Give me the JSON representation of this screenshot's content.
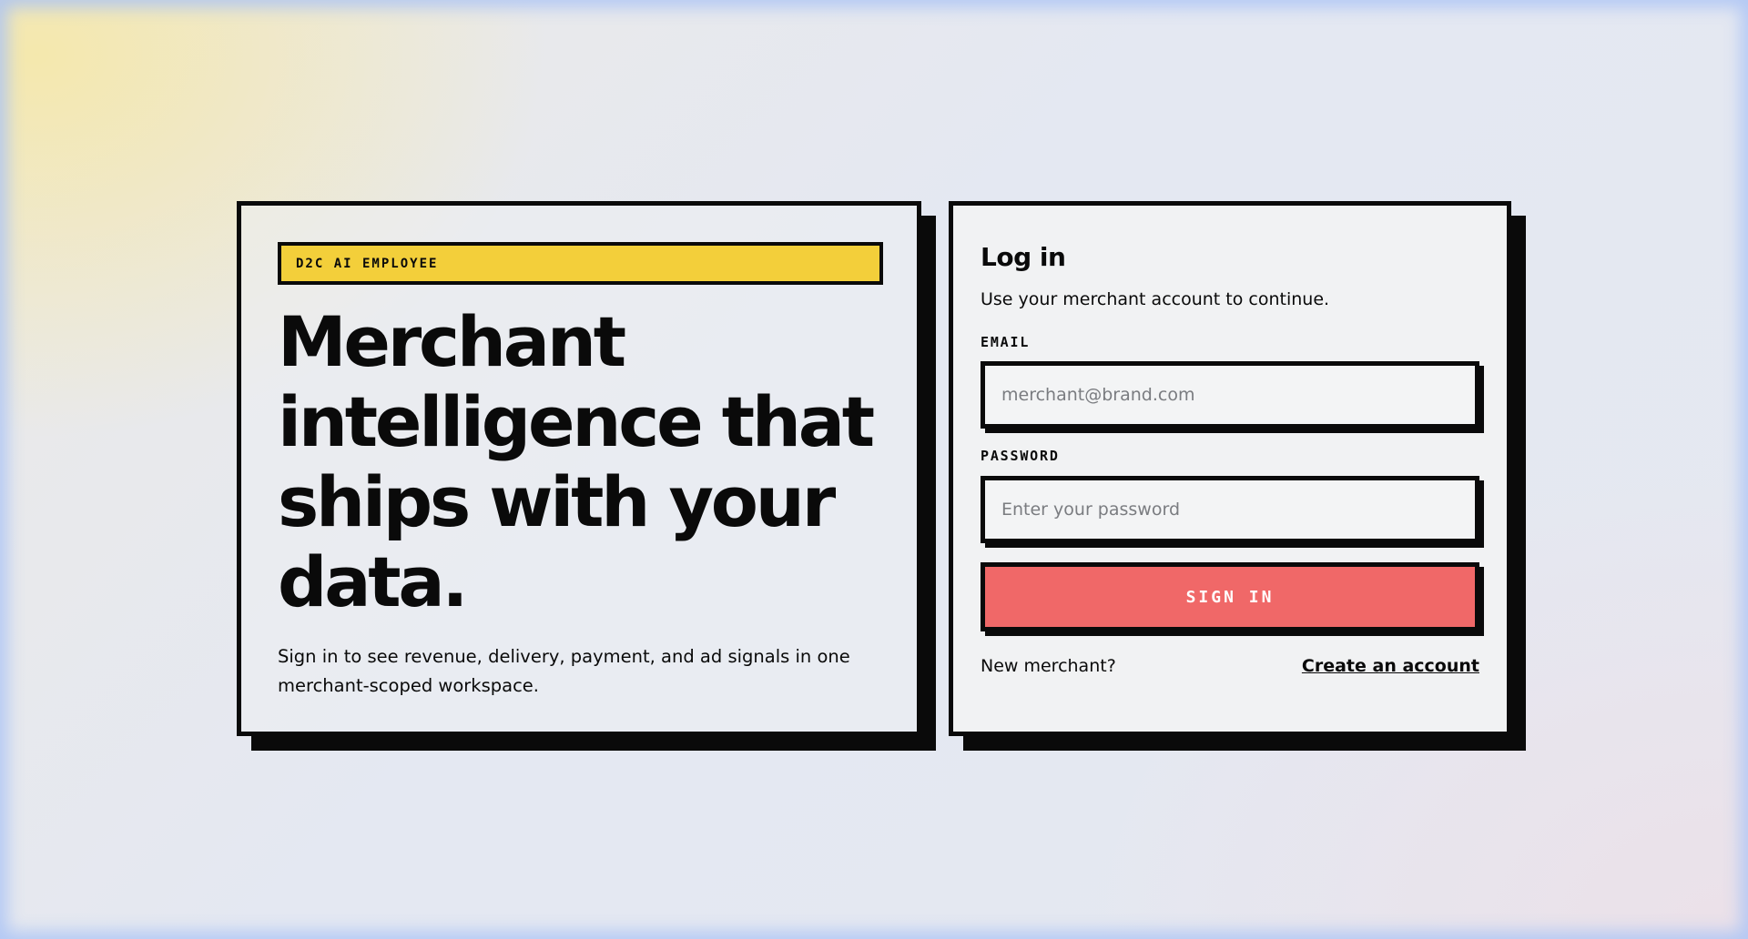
{
  "hero": {
    "eyebrow": "D2C AI EMPLOYEE",
    "headline": "Merchant intelligence that ships with your data.",
    "subtitle": "Sign in to see revenue, delivery, payment, and ad signals in one merchant-scoped workspace."
  },
  "login": {
    "title": "Log in",
    "subtitle": "Use your merchant account to continue.",
    "email_label": "EMAIL",
    "email_placeholder": "merchant@brand.com",
    "email_value": "",
    "password_label": "PASSWORD",
    "password_placeholder": "Enter your password",
    "password_value": "",
    "submit_label": "SIGN IN",
    "new_merchant_text": "New merchant?",
    "create_account_label": "Create an account"
  },
  "colors": {
    "accent_yellow": "#f3cf3a",
    "button_red": "#f06868",
    "border": "#0a0a0a"
  }
}
